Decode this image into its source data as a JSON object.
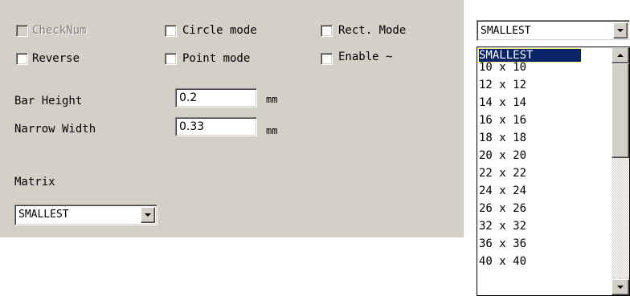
{
  "checkboxes": {
    "checknum": {
      "label": "CheckNum",
      "checked": false,
      "enabled": false
    },
    "reverse": {
      "label": "Reverse",
      "checked": false,
      "enabled": true
    },
    "circle_mode": {
      "label": "Circle mode",
      "checked": false,
      "enabled": true
    },
    "point_mode": {
      "label": "Point mode",
      "checked": false,
      "enabled": true
    },
    "rect_mode": {
      "label": "Rect. Mode",
      "checked": false,
      "enabled": true
    },
    "enable": {
      "label": "Enable ~",
      "checked": false,
      "enabled": true
    }
  },
  "bar_height": {
    "label": "Bar Height",
    "value": "0.2",
    "unit": "mm"
  },
  "narrow_width": {
    "label": "Narrow Width",
    "value": "0.33",
    "unit": "mm"
  },
  "matrix": {
    "label": "Matrix",
    "value": "SMALLEST"
  },
  "dropdown": {
    "value": "SMALLEST",
    "selected_index": 0,
    "items": [
      "SMALLEST",
      "10 x 10",
      "12 x 12",
      "14 x 14",
      "16 x 16",
      "18 x 18",
      "20 x 20",
      "22 x 22",
      "24 x 24",
      "26 x 26",
      "32 x 32",
      "36 x 36",
      "40 x 40"
    ]
  },
  "colors": {
    "panel": "#d4d0c8",
    "selection": "#0a246a",
    "disabled_text": "#808080"
  },
  "icons": {
    "combo_arrow": "chevron-down-icon",
    "scroll_up": "scroll-up-arrow-icon",
    "scroll_down": "scroll-down-arrow-icon"
  }
}
